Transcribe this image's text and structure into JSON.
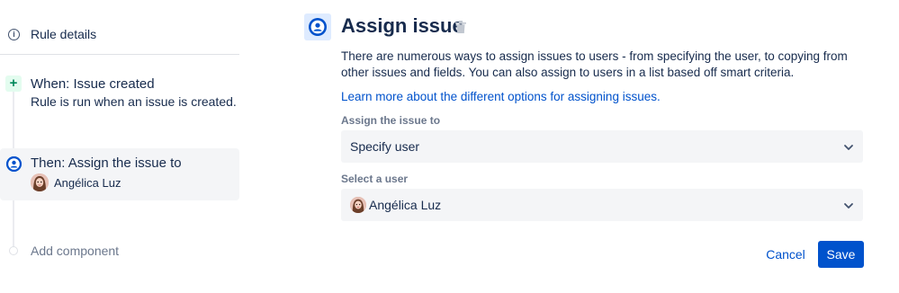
{
  "sidebar": {
    "rule_details": {
      "label": "Rule details",
      "icon": "info-icon"
    },
    "trigger": {
      "icon": "plus-icon",
      "title": "When: Issue created",
      "description": "Rule is run when an issue is created."
    },
    "action": {
      "icon": "user-circle-icon",
      "title": "Then: Assign the issue to",
      "user": "Angélica Luz"
    },
    "add_component": "Add component"
  },
  "panel": {
    "icon": "user-circle-icon",
    "title": "Assign issue",
    "description": "There are numerous ways to assign issues to users - from specifying the user, to copying from other issues and fields. You can also assign to users in a list based off smart criteria.",
    "learn_more": "Learn more about the different options for assigning issues.",
    "assign_field": {
      "label": "Assign the issue to",
      "value": "Specify user"
    },
    "user_field": {
      "label": "Select a user",
      "value": "Angélica Luz"
    },
    "cancel_label": "Cancel",
    "save_label": "Save"
  },
  "colors": {
    "primary": "#0052cc",
    "text": "#172b4d",
    "muted": "#6b778c",
    "field_bg": "#f4f5f7",
    "success_bg": "#e3fcef",
    "success": "#00875a"
  }
}
